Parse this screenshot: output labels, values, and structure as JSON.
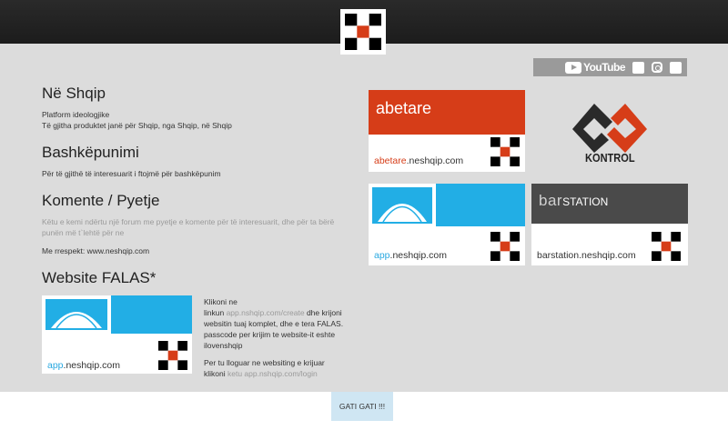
{
  "header": {
    "logo": "neshqip-logo"
  },
  "social": {
    "youtube_label": "YouTube",
    "twitter": "twitter-icon",
    "instagram": "instagram-icon",
    "facebook": "facebook-icon"
  },
  "sections": {
    "shqip": {
      "title": "Në Shqip",
      "line1": "Platform ideologjike",
      "line2": "Të gjitha produktet janë për Shqip, nga Shqip, në Shqip"
    },
    "bashkepunimi": {
      "title": "Bashkëpunimi",
      "line1": "Për të gjithë të interesuarit i ftojmë për bashkëpunim"
    },
    "komente": {
      "title": "Komente / Pyetje",
      "line1": "Këtu e kemi ndërtu një forum me pyetje e komente për të interesuarit, dhe për ta bërë",
      "line2": "punën më t`lehtë për ne",
      "line3": "Me rrespekt: www.neshqip.com"
    },
    "website": {
      "title": "Website FALAS*",
      "t1": "Klikoni ne",
      "t2a": "linkun ",
      "t2link": "app.nshqip.com/create",
      "t2b": " dhe krijoni",
      "t3": "websitin tuaj komplet, dhe e tera FALAS.",
      "t4": "passcode per krijim te website-it eshte",
      "t5": "ilovenshqip",
      "t6": "Per tu lloguar ne websiting e krijuar",
      "t7a": "klikoni ",
      "t7link": "ketu app.nshqip.com/login"
    }
  },
  "cards": {
    "abetare": {
      "top": "abetare",
      "name_a": "abetare",
      ".": "",
      "name_b": ".neshqip.com"
    },
    "kontrol": {
      "label": "KONTROL"
    },
    "app": {
      "name_a": "app",
      "name_b": ".neshqip.com"
    },
    "barstation": {
      "top_a": "bar",
      "top_b": "STATION",
      "name": "barstation.neshqip.com"
    },
    "website_card": {
      "name_a": "app",
      "name_b": ".neshqip.com"
    }
  },
  "footer": {
    "button": "GATI GATI !!!"
  },
  "colors": {
    "red": "#d63d18",
    "blue": "#22aee5",
    "dark": "#4a4a4a"
  }
}
